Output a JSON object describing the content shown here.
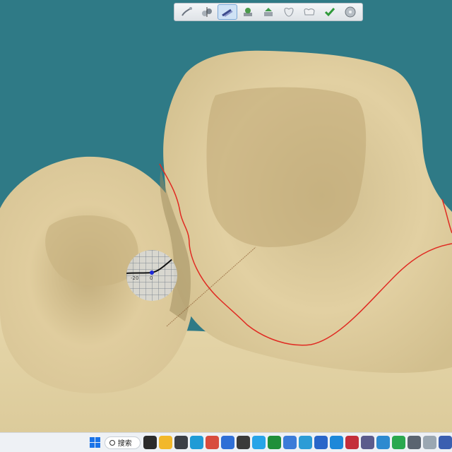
{
  "toolbar": {
    "tools": [
      {
        "icon": "margin-line-icon"
      },
      {
        "icon": "insertion-axis-icon"
      },
      {
        "icon": "instruments-icon",
        "active": true
      },
      {
        "icon": "design-wizard-icon"
      },
      {
        "icon": "adapt-icon"
      },
      {
        "icon": "tooth-anatomy-icon"
      },
      {
        "icon": "tooth-crown-icon"
      },
      {
        "icon": "confirm-check-icon"
      },
      {
        "icon": "save-disc-icon"
      }
    ]
  },
  "lens": {
    "scale_label": "-20",
    "zero_label": "0"
  },
  "taskbar": {
    "search_label": "搜索",
    "apps": [
      {
        "name": "task-view-icon",
        "color": "#2b2b2b"
      },
      {
        "name": "file-explorer-icon",
        "color": "#f2b82a"
      },
      {
        "name": "camera-app-icon",
        "color": "#3b3f46"
      },
      {
        "name": "edge-icon",
        "color": "#1f9bd6"
      },
      {
        "name": "chrome-icon",
        "color": "#d84c3e"
      },
      {
        "name": "store-icon",
        "color": "#2f6fd6"
      },
      {
        "name": "ai-app-icon",
        "color": "#3a3a3a"
      },
      {
        "name": "browser-icon",
        "color": "#27a4e8"
      },
      {
        "name": "app-green-icon",
        "color": "#1f8f3a"
      },
      {
        "name": "mail-icon",
        "color": "#3b7bd8"
      },
      {
        "name": "photos-icon",
        "color": "#2c9cd6"
      },
      {
        "name": "ks-app-icon",
        "color": "#2a66c9"
      },
      {
        "name": "code-app-icon",
        "color": "#1d88d9"
      },
      {
        "name": "video-app-icon",
        "color": "#c42f3b"
      },
      {
        "name": "dev-app-icon",
        "color": "#5b5b8c"
      },
      {
        "name": "remote-app-icon",
        "color": "#2d8ad0"
      },
      {
        "name": "chat-app-icon",
        "color": "#2aa84f"
      },
      {
        "name": "dental-tool-icon",
        "color": "#5a6470"
      },
      {
        "name": "dental-cad-icon",
        "color": "#9aa7b2"
      },
      {
        "name": "design-app-icon",
        "color": "#3b5fb0"
      }
    ]
  },
  "colors": {
    "background": "#2f7a86",
    "model": "#e6d5a8",
    "margin_line": "#e02a22"
  }
}
